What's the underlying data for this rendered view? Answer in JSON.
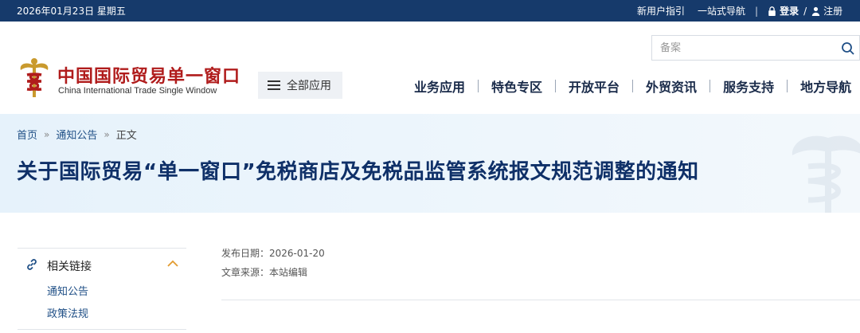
{
  "topbar": {
    "date": "2026年01月23日 星期五",
    "links": [
      "新用户指引",
      "一站式导航"
    ],
    "login": "登录",
    "slash": "/",
    "register": "注册"
  },
  "header": {
    "logo_cn": "中国国际贸易单一窗口",
    "logo_en": "China International Trade Single Window",
    "all_apps": "全部应用",
    "search_placeholder": "备案",
    "nav": [
      "业务应用",
      "特色专区",
      "开放平台",
      "外贸资讯",
      "服务支持",
      "地方导航"
    ]
  },
  "breadcrumb": [
    "首页",
    "通知公告",
    "正文"
  ],
  "article": {
    "title": "关于国际贸易“单一窗口”免税商店及免税品监管系统报文规范调整的通知",
    "publish_label": "发布日期：",
    "publish_date": "2026-01-20",
    "source_label": "文章来源：",
    "source": "本站编辑"
  },
  "sidebar": {
    "title": "相关链接",
    "items": [
      "通知公告",
      "政策法规"
    ]
  },
  "colors": {
    "topbar_bg": "#163a6b",
    "title_blue": "#0f3068",
    "logo_red": "#b01c1c",
    "banner_bg": "#e6f2fb"
  }
}
